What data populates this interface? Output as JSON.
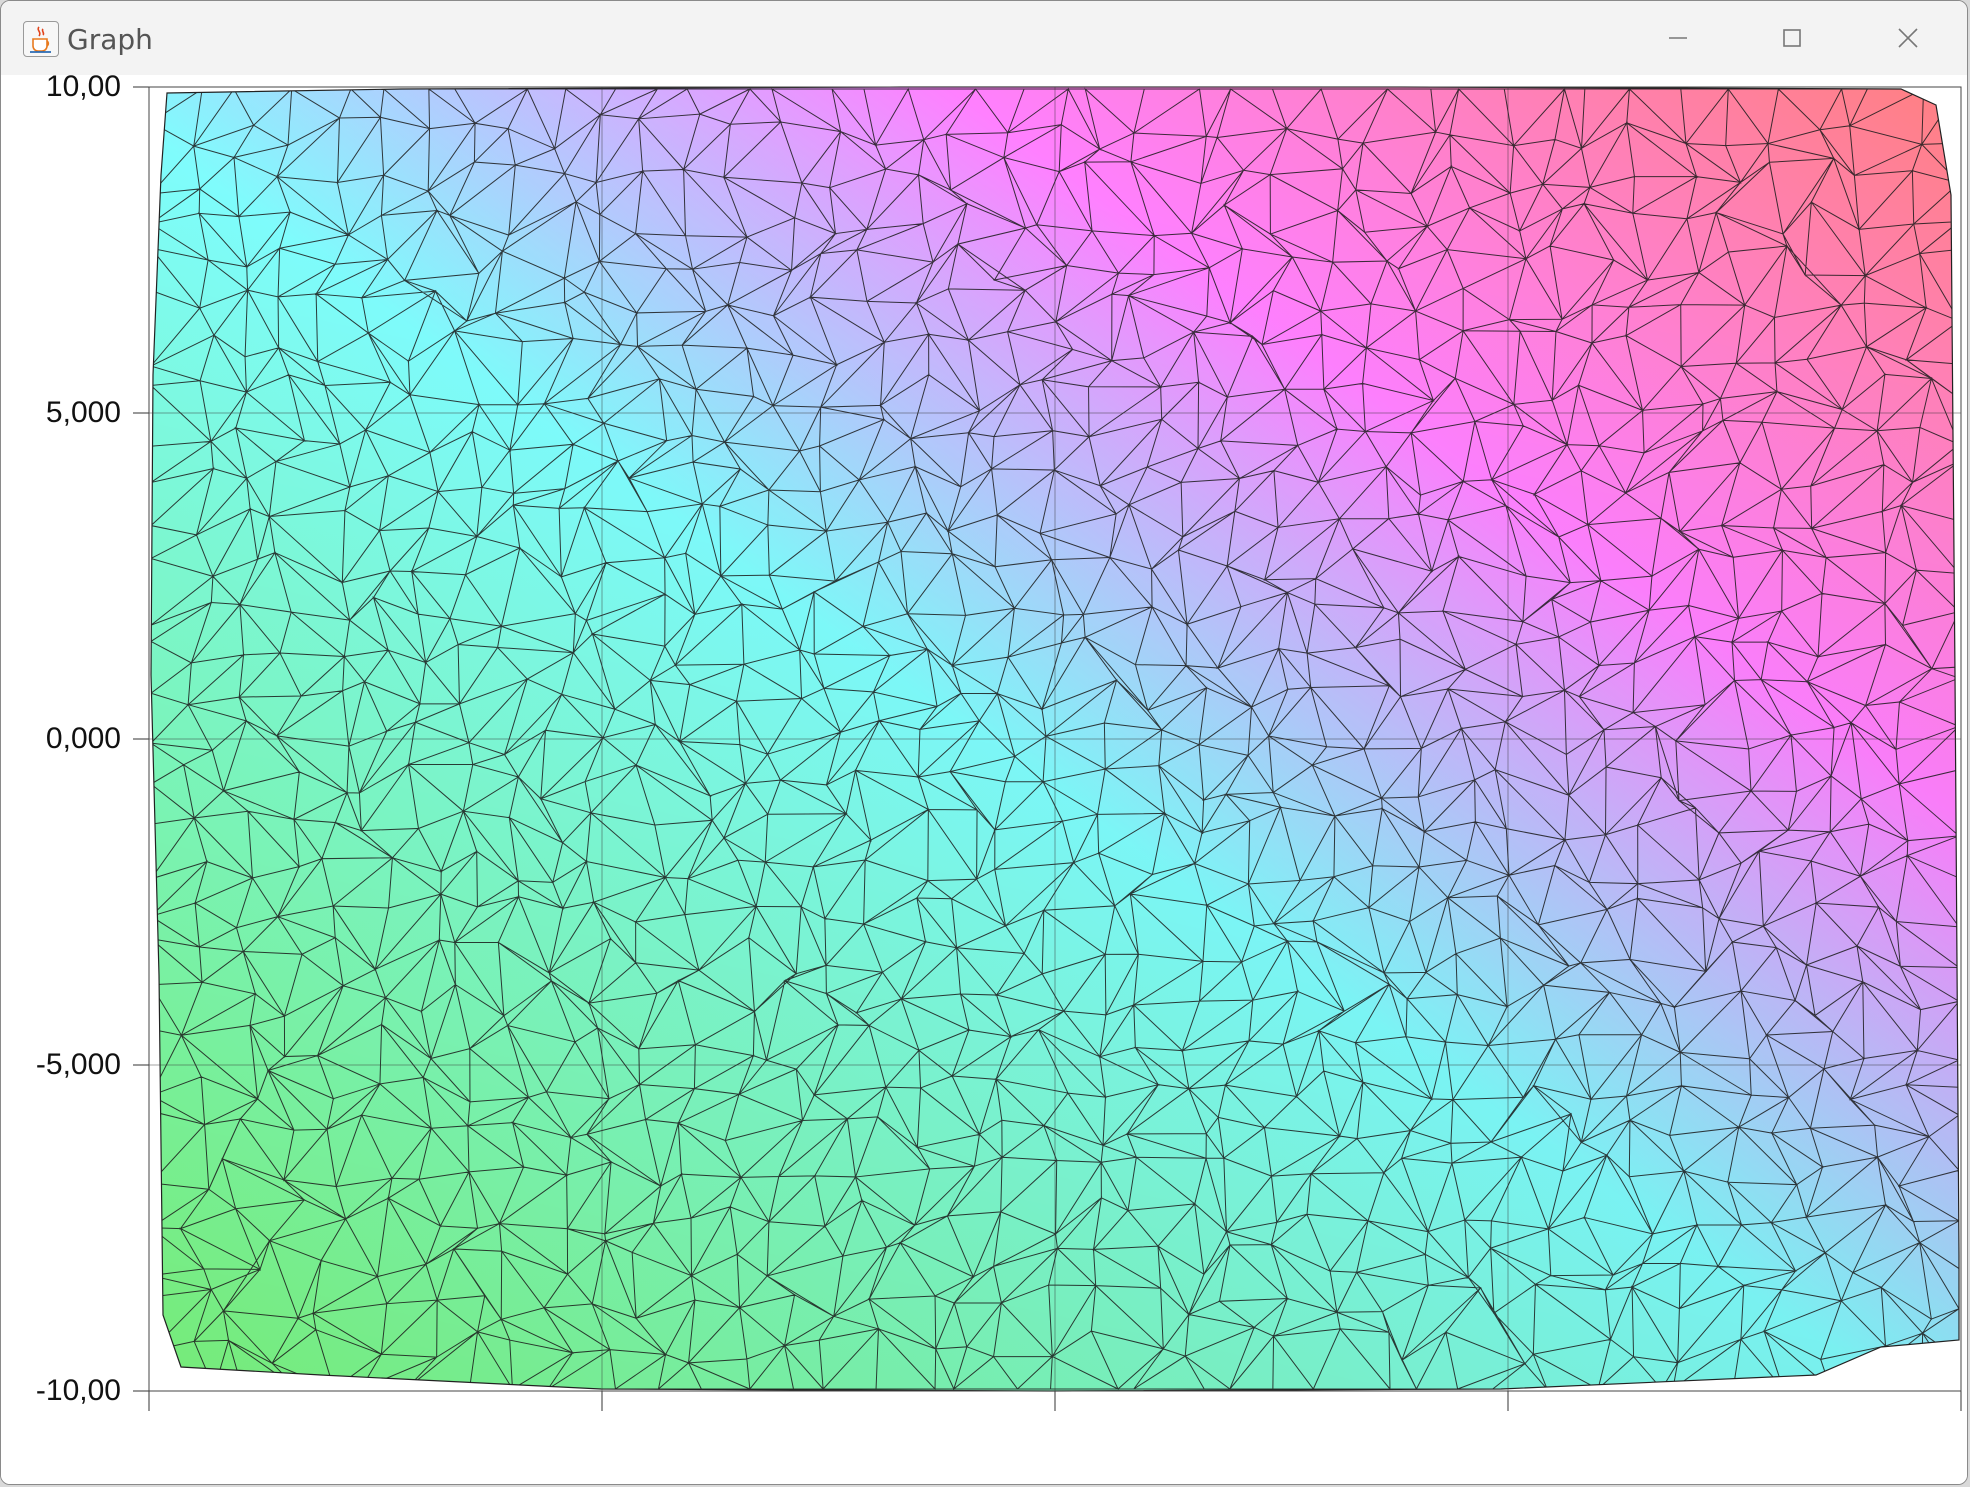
{
  "window": {
    "title": "Graph",
    "icon": "java-cup-icon",
    "controls": [
      "minimize-icon",
      "maximize-icon",
      "close-icon"
    ]
  },
  "chart_data": {
    "type": "heatmap",
    "title": "",
    "xlabel": "",
    "ylabel": "",
    "ylim": [
      -10,
      10
    ],
    "y_tick_labels": [
      "10,00",
      "5,000",
      "0,000",
      "-5,000",
      "-10,00"
    ],
    "y_ticks": [
      10,
      5,
      0,
      -5,
      -10
    ],
    "x_ticks_count": 5,
    "x_tick_labels": [],
    "grid": true,
    "colors": {
      "top_right": "#ff8080",
      "upper_left": "#ff80ff",
      "middle": "#80ffff",
      "bottom_left": "#80ff80"
    }
  }
}
